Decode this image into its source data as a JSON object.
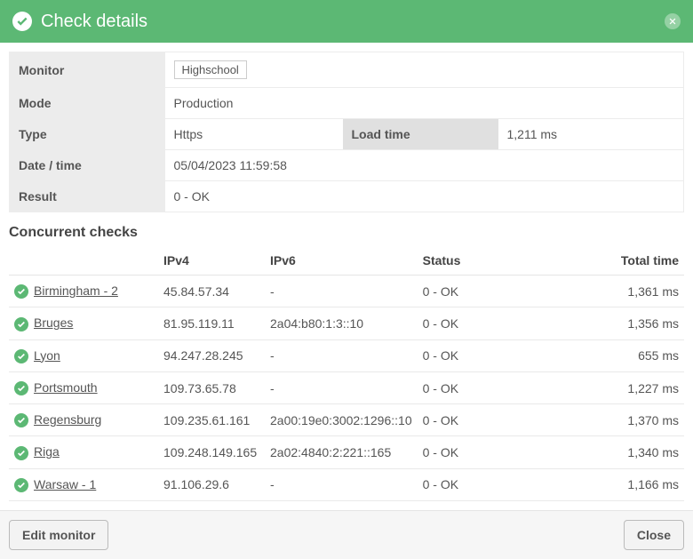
{
  "header": {
    "title": "Check details"
  },
  "details": {
    "monitor_label": "Monitor",
    "monitor_value": "Highschool",
    "mode_label": "Mode",
    "mode_value": "Production",
    "type_label": "Type",
    "type_value": "Https",
    "loadtime_label": "Load time",
    "loadtime_value": "1,211 ms",
    "datetime_label": "Date / time",
    "datetime_value": "05/04/2023 11:59:58",
    "result_label": "Result",
    "result_value": "0 - OK"
  },
  "concurrent": {
    "title": "Concurrent checks",
    "columns": {
      "ipv4": "IPv4",
      "ipv6": "IPv6",
      "status": "Status",
      "total_time": "Total time"
    },
    "rows": [
      {
        "location": "Birmingham - 2",
        "ipv4": "45.84.57.34",
        "ipv6": "-",
        "status": "0 - OK",
        "total_time": "1,361 ms"
      },
      {
        "location": "Bruges",
        "ipv4": "81.95.119.11",
        "ipv6": "2a04:b80:1:3::10",
        "status": "0 - OK",
        "total_time": "1,356 ms"
      },
      {
        "location": "Lyon",
        "ipv4": "94.247.28.245",
        "ipv6": "-",
        "status": "0 - OK",
        "total_time": "655 ms"
      },
      {
        "location": "Portsmouth",
        "ipv4": "109.73.65.78",
        "ipv6": "-",
        "status": "0 - OK",
        "total_time": "1,227 ms"
      },
      {
        "location": "Regensburg",
        "ipv4": "109.235.61.161",
        "ipv6": "2a00:19e0:3002:1296::10",
        "status": "0 - OK",
        "total_time": "1,370 ms"
      },
      {
        "location": "Riga",
        "ipv4": "109.248.149.165",
        "ipv6": "2a02:4840:2:221::165",
        "status": "0 - OK",
        "total_time": "1,340 ms"
      },
      {
        "location": "Warsaw - 1",
        "ipv4": "91.106.29.6",
        "ipv6": "-",
        "status": "0 - OK",
        "total_time": "1,166 ms"
      }
    ]
  },
  "footer": {
    "edit_label": "Edit monitor",
    "close_label": "Close"
  }
}
